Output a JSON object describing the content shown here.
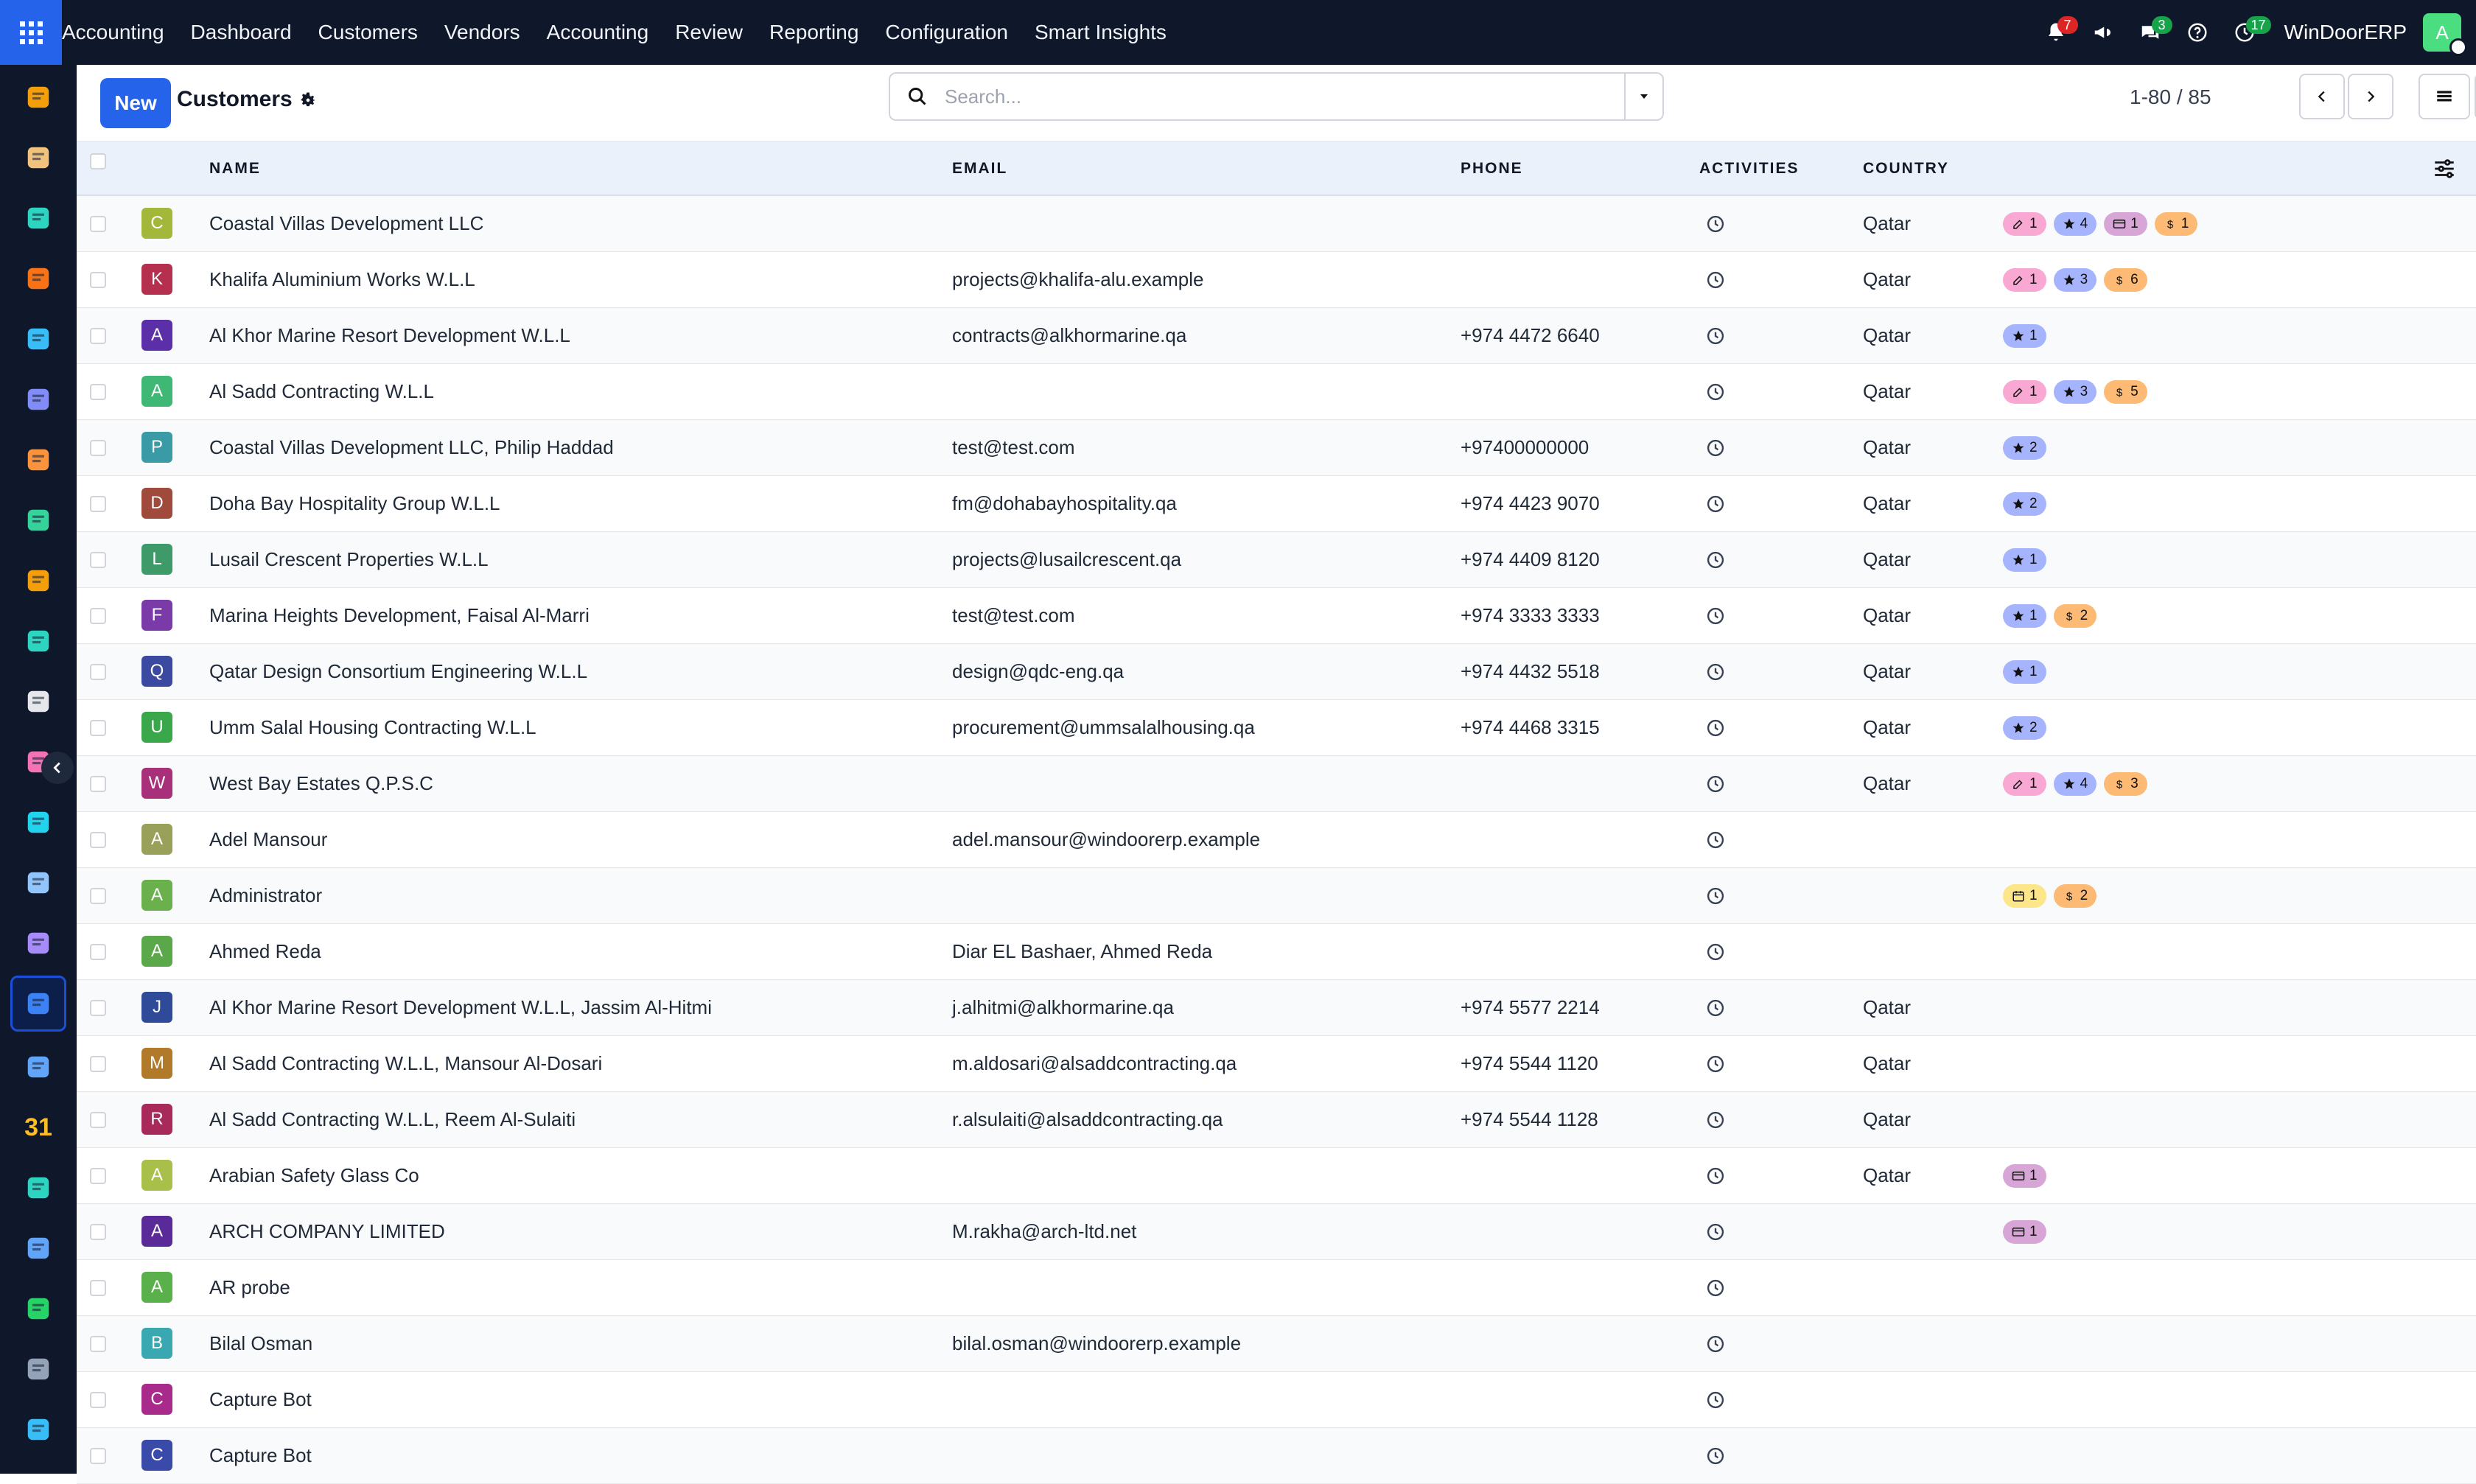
{
  "topbar": {
    "menu": [
      "Accounting",
      "Dashboard",
      "Customers",
      "Vendors",
      "Accounting",
      "Review",
      "Reporting",
      "Configuration",
      "Smart Insights"
    ],
    "notifications": "7",
    "messages": "3",
    "activities": "17",
    "company": "WinDoorERP",
    "user_initial": "A"
  },
  "control_panel": {
    "new_label": "New",
    "title": "Customers",
    "search_placeholder": "Search...",
    "pager": "1-80 / 85"
  },
  "table": {
    "headers": {
      "name": "NAME",
      "email": "EMAIL",
      "phone": "PHONE",
      "activities": "ACTIVITIES",
      "country": "COUNTRY"
    },
    "rows": [
      {
        "initial": "C",
        "color": "#a3b83a",
        "name": "Coastal Villas Development LLC",
        "email": "",
        "phone": "",
        "country": "Qatar",
        "tags": [
          {
            "kind": "pink",
            "icon": "edit",
            "n": "1"
          },
          {
            "kind": "blue",
            "icon": "star",
            "n": "4"
          },
          {
            "kind": "purple",
            "icon": "card",
            "n": "1"
          },
          {
            "kind": "orange",
            "icon": "dollar",
            "n": "1"
          }
        ]
      },
      {
        "initial": "K",
        "color": "#b5304f",
        "name": "Khalifa Aluminium Works W.L.L",
        "email": "projects@khalifa-alu.example",
        "phone": "",
        "country": "Qatar",
        "tags": [
          {
            "kind": "pink",
            "icon": "edit",
            "n": "1"
          },
          {
            "kind": "blue",
            "icon": "star",
            "n": "3"
          },
          {
            "kind": "orange",
            "icon": "dollar",
            "n": "6"
          }
        ]
      },
      {
        "initial": "A",
        "color": "#5b2fa8",
        "name": "Al Khor Marine Resort Development W.L.L",
        "email": "contracts@alkhormarine.qa",
        "phone": "+974 4472 6640",
        "country": "Qatar",
        "tags": [
          {
            "kind": "blue",
            "icon": "star",
            "n": "1"
          }
        ]
      },
      {
        "initial": "A",
        "color": "#3fb876",
        "name": "Al Sadd Contracting W.L.L",
        "email": "",
        "phone": "",
        "country": "Qatar",
        "tags": [
          {
            "kind": "pink",
            "icon": "edit",
            "n": "1"
          },
          {
            "kind": "blue",
            "icon": "star",
            "n": "3"
          },
          {
            "kind": "orange",
            "icon": "dollar",
            "n": "5"
          }
        ]
      },
      {
        "initial": "P",
        "color": "#3a9aa6",
        "name": "Coastal Villas Development LLC, Philip Haddad",
        "email": "test@test.com",
        "phone": "+97400000000",
        "country": "Qatar",
        "tags": [
          {
            "kind": "blue",
            "icon": "star",
            "n": "2"
          }
        ]
      },
      {
        "initial": "D",
        "color": "#a04a3c",
        "name": "Doha Bay Hospitality Group W.L.L",
        "email": "fm@dohabayhospitality.qa",
        "phone": "+974 4423 9070",
        "country": "Qatar",
        "tags": [
          {
            "kind": "blue",
            "icon": "star",
            "n": "2"
          }
        ]
      },
      {
        "initial": "L",
        "color": "#3f9a6a",
        "name": "Lusail Crescent Properties W.L.L",
        "email": "projects@lusailcrescent.qa",
        "phone": "+974 4409 8120",
        "country": "Qatar",
        "tags": [
          {
            "kind": "blue",
            "icon": "star",
            "n": "1"
          }
        ]
      },
      {
        "initial": "F",
        "color": "#7a3aa8",
        "name": "Marina Heights Development, Faisal Al-Marri",
        "email": "test@test.com",
        "phone": "+974 3333 3333",
        "country": "Qatar",
        "tags": [
          {
            "kind": "blue",
            "icon": "star",
            "n": "1"
          },
          {
            "kind": "orange",
            "icon": "dollar",
            "n": "2"
          }
        ]
      },
      {
        "initial": "Q",
        "color": "#3b4aa0",
        "name": "Qatar Design Consortium Engineering W.L.L",
        "email": "design@qdc-eng.qa",
        "phone": "+974 4432 5518",
        "country": "Qatar",
        "tags": [
          {
            "kind": "blue",
            "icon": "star",
            "n": "1"
          }
        ]
      },
      {
        "initial": "U",
        "color": "#3aa84a",
        "name": "Umm Salal Housing Contracting W.L.L",
        "email": "procurement@ummsalalhousing.qa",
        "phone": "+974 4468 3315",
        "country": "Qatar",
        "tags": [
          {
            "kind": "blue",
            "icon": "star",
            "n": "2"
          }
        ]
      },
      {
        "initial": "W",
        "color": "#a8307a",
        "name": "West Bay Estates Q.P.S.C",
        "email": "",
        "phone": "",
        "country": "Qatar",
        "tags": [
          {
            "kind": "pink",
            "icon": "edit",
            "n": "1"
          },
          {
            "kind": "blue",
            "icon": "star",
            "n": "4"
          },
          {
            "kind": "orange",
            "icon": "dollar",
            "n": "3"
          }
        ]
      },
      {
        "initial": "A",
        "color": "#98a05a",
        "name": "Adel Mansour",
        "email": "adel.mansour@windoorerp.example",
        "phone": "",
        "country": "",
        "tags": []
      },
      {
        "initial": "A",
        "color": "#6ab04c",
        "name": "Administrator",
        "email": "",
        "phone": "",
        "country": "",
        "tags": [
          {
            "kind": "yellow",
            "icon": "calendar",
            "n": "1"
          },
          {
            "kind": "orange",
            "icon": "dollar",
            "n": "2"
          }
        ]
      },
      {
        "initial": "A",
        "color": "#5aa84a",
        "name": "Ahmed Reda",
        "email": "Diar EL Bashaer, Ahmed Reda",
        "phone": "",
        "country": "",
        "tags": []
      },
      {
        "initial": "J",
        "color": "#2f4a98",
        "name": "Al Khor Marine Resort Development W.L.L, Jassim Al-Hitmi",
        "email": "j.alhitmi@alkhormarine.qa",
        "phone": "+974 5577 2214",
        "country": "Qatar",
        "tags": []
      },
      {
        "initial": "M",
        "color": "#b07a2a",
        "name": "Al Sadd Contracting W.L.L, Mansour Al-Dosari",
        "email": "m.aldosari@alsaddcontracting.qa",
        "phone": "+974 5544 1120",
        "country": "Qatar",
        "tags": []
      },
      {
        "initial": "R",
        "color": "#a82a5a",
        "name": "Al Sadd Contracting W.L.L, Reem Al-Sulaiti",
        "email": "r.alsulaiti@alsaddcontracting.qa",
        "phone": "+974 5544 1128",
        "country": "Qatar",
        "tags": []
      },
      {
        "initial": "A",
        "color": "#a8c04a",
        "name": "Arabian Safety Glass Co",
        "email": "",
        "phone": "",
        "country": "Qatar",
        "tags": [
          {
            "kind": "purple",
            "icon": "card",
            "n": "1"
          }
        ]
      },
      {
        "initial": "A",
        "color": "#5a2a98",
        "name": "ARCH COMPANY LIMITED",
        "email": "M.rakha@arch-ltd.net",
        "phone": "",
        "country": "",
        "tags": [
          {
            "kind": "purple",
            "icon": "card",
            "n": "1"
          }
        ]
      },
      {
        "initial": "A",
        "color": "#5ab04a",
        "name": "AR probe",
        "email": "",
        "phone": "",
        "country": "",
        "tags": []
      },
      {
        "initial": "B",
        "color": "#3aa8b0",
        "name": "Bilal Osman",
        "email": "bilal.osman@windoorerp.example",
        "phone": "",
        "country": "",
        "tags": []
      },
      {
        "initial": "C",
        "color": "#a82a8a",
        "name": "Capture Bot",
        "email": "",
        "phone": "",
        "country": "",
        "tags": []
      },
      {
        "initial": "C",
        "color": "#3a4aa8",
        "name": "Capture Bot",
        "email": "",
        "phone": "",
        "country": "",
        "tags": []
      }
    ]
  },
  "sidebar": {
    "icons": [
      "invoicing-icon",
      "expenses-icon",
      "contacts-icon",
      "discuss-icon",
      "website-icon",
      "mail-icon",
      "livechat-icon",
      "inventory-icon",
      "reports-icon",
      "employees-icon",
      "product-icon",
      "documents-icon",
      "todo-icon",
      "knowledge-icon",
      "barcode-icon",
      "accounting-app-icon",
      "team-icon",
      "calendar-icon",
      "sign-icon",
      "dashboards-icon",
      "whatsapp-icon",
      "timer-icon",
      "studio-icon"
    ],
    "calendar_day": "31"
  },
  "colors": {
    "accent": "#2563eb",
    "topbar": "#0f172a",
    "header_row": "#eaf1fb"
  }
}
